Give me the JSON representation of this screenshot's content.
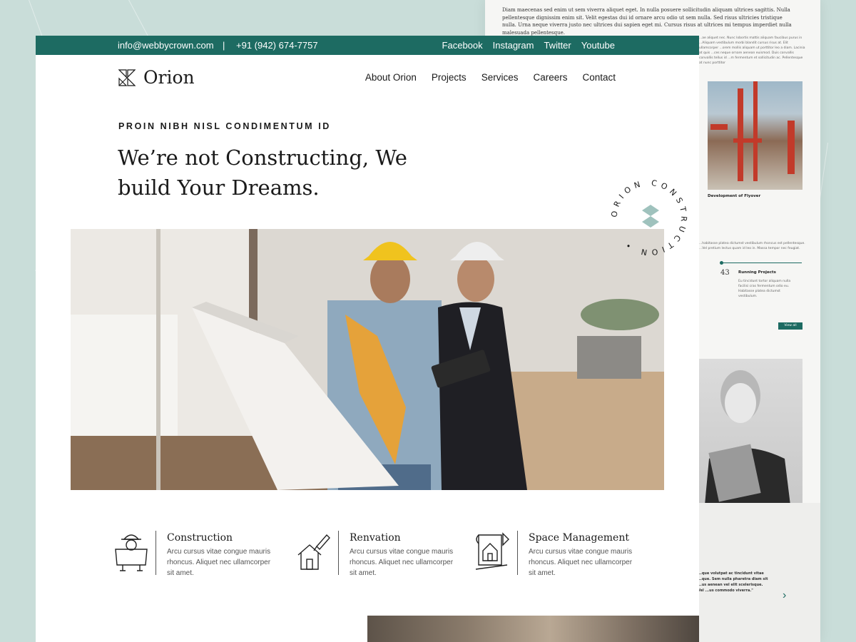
{
  "back_page": {
    "intro_text": "Diam maecenas sed enim ut sem viverra aliquet eget. In nulla posuere sollicitudin aliquam ultrices sagittis. Nulla pellentesque dignissim enim sit. Velit egestas dui id ornare arcu odio ut sem nulla. Sed risus ultricies tristique nulla. Urna neque viverra justo nec ultrices dui sapien eget mi. Cursus risus at ultrices mi tempus imperdiet nulla malesuada pellentesque.",
    "column_text": "...ae aliquet nec. Nunc lobortis mattis aliquam faucibus purus in ...Aliquam vestibulum morbi blandit cursus risus at. Elit ullamcorper ...orem mollis aliquam ut porttitor leo a diam. Lacinia at quis ...ces neque ornare aenean euismod. Duis convallis convallis tellus id ...m fermentum et sollicitudin ac. Pellentesque at nunc porttitor",
    "photo_caption": "Development of Flyover",
    "para_2": "...habitasse platea dictumst vestibulum rhoncus est pellentesque. ...Vel pretium lectus quam id leo in. Massa tempor nec feugiat.",
    "stat_number": "43",
    "stat_label": "Running Projects",
    "stat_desc": "Eu tincidunt tortor aliquam nulla facilisi cras fermentum odio eu. Habitasse platea dictumst vestibulum.",
    "view_all": "View all",
    "quote": "...que volutpat ac tincidunt vitae ...que. Sem nulla pharetra diam sit ...us aenean vel elit scelerisque. Vel ...us commodo viverra.\""
  },
  "topbar": {
    "email": "info@webbycrown.com",
    "separator": "|",
    "phone": "+91 (942) 674-7757",
    "social": [
      "Facebook",
      "Instagram",
      "Twitter",
      "Youtube"
    ]
  },
  "brand": {
    "name": "Orion"
  },
  "nav": [
    "About Orion",
    "Projects",
    "Services",
    "Careers",
    "Contact"
  ],
  "hero": {
    "kicker": "PROIN NIBH NISL CONDIMENTUM ID",
    "headline": "We’re not Constructing, We build Your Dreams."
  },
  "badge": {
    "text": "ORION CONSTRUCTION •"
  },
  "features": [
    {
      "icon": "construction-worker-icon",
      "title": "Construction",
      "desc": "Arcu cursus vitae congue mauris rhoncus. Aliquet nec ullamcorper sit amet."
    },
    {
      "icon": "house-paint-icon",
      "title": "Renvation",
      "desc": "Arcu cursus vitae congue mauris rhoncus. Aliquet nec ullamcorper sit amet."
    },
    {
      "icon": "blueprint-house-icon",
      "title": "Space Management",
      "desc": "Arcu cursus vitae congue mauris rhoncus. Aliquet nec ullamcorper sit amet."
    }
  ],
  "colors": {
    "accent": "#1d6b62",
    "background": "#c9ddd9",
    "text": "#1a1a1a"
  }
}
